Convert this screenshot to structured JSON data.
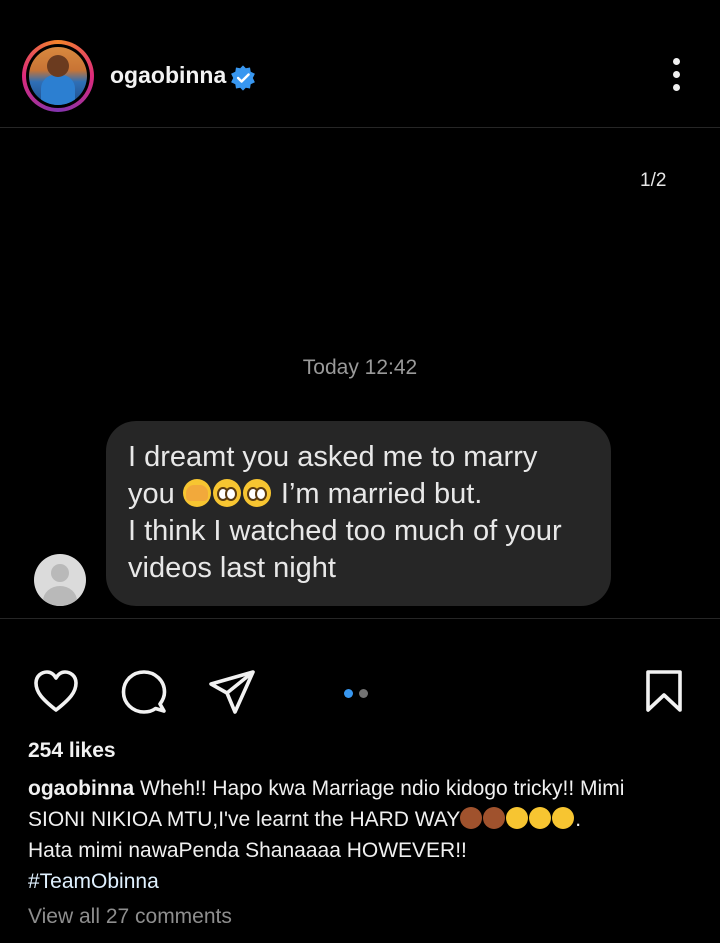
{
  "header": {
    "username": "ogaobinna",
    "verified": true,
    "more_icon": "more-vertical-icon"
  },
  "media": {
    "counter": "1/2",
    "timestamp": "Today 12:42",
    "message": {
      "line1": "I dreamt you asked me to marry",
      "line2_start": "you",
      "line2_end": "I’m married but.",
      "line3": "I think I watched too much of your",
      "line4": "videos last night"
    }
  },
  "actions": {
    "like_icon": "heart-icon",
    "comment_icon": "comment-icon",
    "share_icon": "send-icon",
    "save_icon": "bookmark-icon",
    "carousel_total": 2,
    "carousel_current": 1,
    "accent": "#3897f0"
  },
  "post": {
    "likes": "254 likes",
    "caption_user": "ogaobinna",
    "caption_line1": "Wheh!! Hapo kwa Marriage ndio kidogo tricky!! Mimi",
    "caption_line2": "SIONI NIKIOA MTU,I've learnt the HARD WAY",
    "caption_line3": "Hata mimi nawaPenda Shanaaaa HOWEVER!!",
    "hashtag": "#TeamObinna",
    "view_comments": "View all 27 comments"
  }
}
